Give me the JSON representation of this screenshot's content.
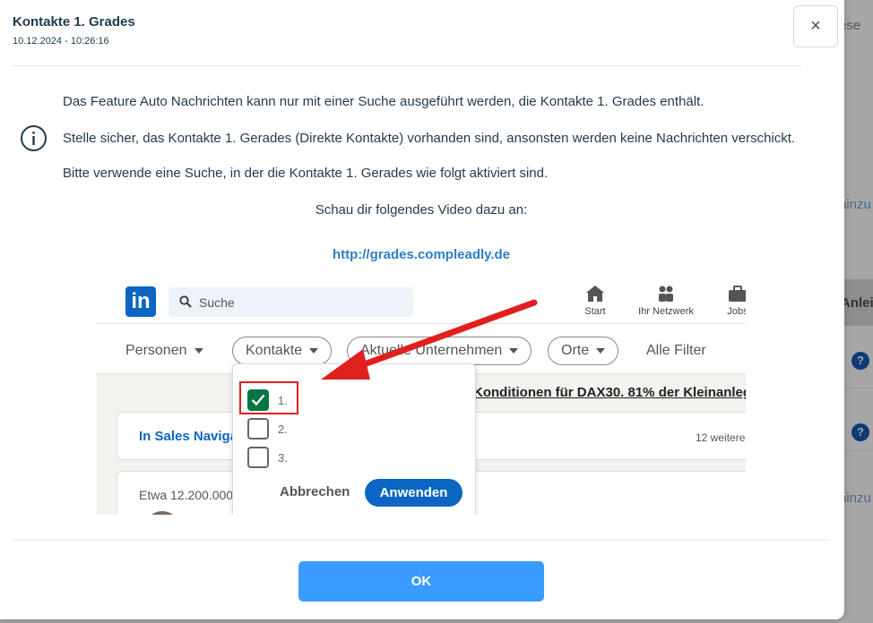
{
  "background": {
    "text_top": "ese",
    "link_1": "hinzu",
    "tab_label": "Anleit",
    "help_icon": "?",
    "link_2": "hinzu"
  },
  "modal": {
    "title": "Kontakte 1. Grades",
    "timestamp": "10.12.2024 - 10:26:16",
    "close_icon": "×",
    "messages": [
      "Das Feature Auto Nachrichten kann nur mit einer Suche ausgeführt werden, die Kontakte 1. Grades enthält.",
      "Stelle sicher, das Kontakte 1. Gerades (Direkte Kontakte) vorhanden sind, ansonsten werden keine Nachrichten verschickt.",
      "Bitte verwende eine Suche, in der die Kontakte 1. Gerades wie folgt aktiviert sind."
    ],
    "video_hint": "Schau dir folgendes Video dazu an:",
    "video_link": "http://grades.compleadly.de",
    "ok_label": "OK"
  },
  "screenshot": {
    "logo": "in",
    "search_placeholder": "Suche",
    "nav": [
      "Start",
      "Ihr Netzwerk",
      "Jobs"
    ],
    "filters": [
      "Personen",
      "Kontakte",
      "Aktuelle Unternehmen",
      "Orte",
      "Alle Filter"
    ],
    "ad_text": "Konditionen für DAX30. 81% der Kleinanleg",
    "card_title": "In Sales Naviga",
    "card_more": "12 weitere",
    "results_text": "Etwa 12.200.000",
    "options": [
      "1.",
      "2.",
      "3."
    ],
    "option_checked": [
      true,
      false,
      false
    ],
    "cancel_label": "Abbrechen",
    "apply_label": "Anwenden"
  },
  "colors": {
    "accent": "#3b9cff",
    "link": "#2d7fc6",
    "linkedin_blue": "#0a66c2",
    "checkbox_green": "#057642",
    "annotation_red": "#e01f1f"
  }
}
